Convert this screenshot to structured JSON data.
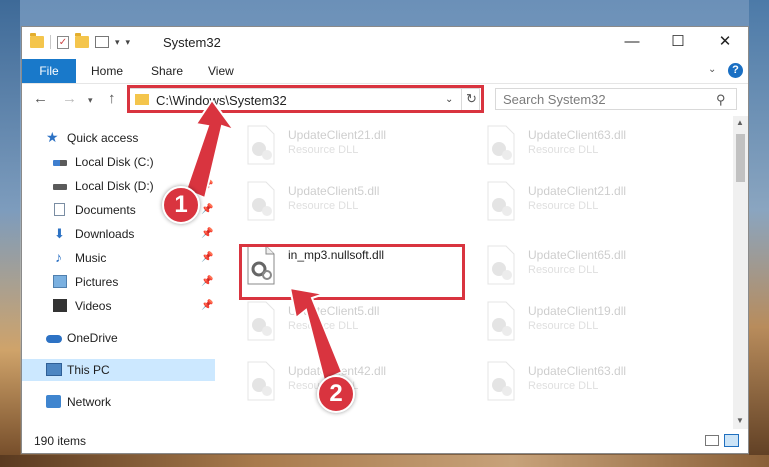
{
  "window": {
    "title": "System32",
    "min_glyph": "—",
    "max_glyph": "☐",
    "close_glyph": "✕",
    "qat_check_glyph": "✓",
    "qat_dropdown_glyph": "▾",
    "qat_more_glyph": "▾"
  },
  "ribbon": {
    "tabs": [
      "File",
      "Home",
      "Share",
      "View"
    ],
    "collapse_glyph": "⌄",
    "help_glyph": "?"
  },
  "navbar": {
    "back_glyph": "←",
    "forward_glyph": "→",
    "recent_glyph": "▾",
    "up_glyph": "↑",
    "address": "C:\\Windows\\System32",
    "address_dropdown_glyph": "⌄",
    "refresh_glyph": "↻",
    "search_placeholder": "Search System32",
    "search_glyph": "⚲"
  },
  "nav_pane": {
    "quick_access": "Quick access",
    "items": [
      {
        "label": "Local Disk (C:)",
        "pinned": true
      },
      {
        "label": "Local Disk (D:)",
        "pinned": true
      },
      {
        "label": "Documents",
        "pinned": true
      },
      {
        "label": "Downloads",
        "pinned": true
      },
      {
        "label": "Music",
        "pinned": true
      },
      {
        "label": "Pictures",
        "pinned": true
      },
      {
        "label": "Videos",
        "pinned": true
      }
    ],
    "pin_glyph": "📌",
    "onedrive": "OneDrive",
    "this_pc": "This PC",
    "network": "Network",
    "star_glyph": "★",
    "download_glyph": "⬇",
    "music_glyph": "♪"
  },
  "files": {
    "highlighted": {
      "name": "in_mp3.nullsoft.dll"
    },
    "faded": [
      {
        "name": "UpdateClient21.dll",
        "desc": "Resource DLL"
      },
      {
        "name": "UpdateClient63.dll",
        "desc": "Resource DLL"
      },
      {
        "name": "UpdateClient5.dll",
        "desc": "Resource DLL"
      },
      {
        "name": "UpdateClient21.dll",
        "desc": "Resource DLL"
      },
      {
        "name": "UpdateClient65.dll",
        "desc": "Resource DLL"
      },
      {
        "name": "UpdateClient5.dll",
        "desc": "Resource DLL"
      },
      {
        "name": "UpdateClient19.dll",
        "desc": "Resource DLL"
      },
      {
        "name": "UpdateClient42.dll",
        "desc": "Resource DLL"
      },
      {
        "name": "UpdateClient63.dll",
        "desc": "Resource DLL"
      }
    ]
  },
  "scrollbar": {
    "up_glyph": "▲",
    "down_glyph": "▼"
  },
  "status": {
    "item_count": "190 items"
  },
  "annotations": {
    "step1": "1",
    "step2": "2",
    "accent_color": "#d9343f"
  }
}
